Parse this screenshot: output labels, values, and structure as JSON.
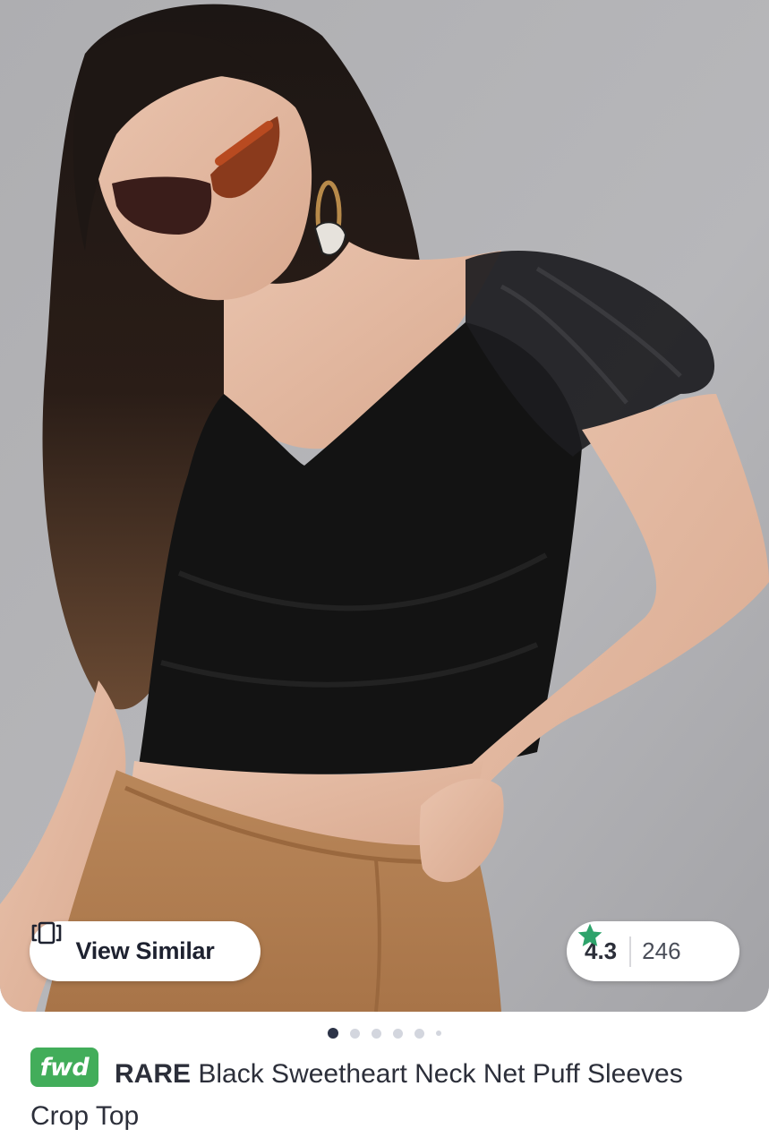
{
  "product": {
    "image_alt": "Model wearing black sweetheart neck crop top with puff net sleeves",
    "view_similar_label": "View Similar",
    "rating": {
      "value": "4.3",
      "count": "246",
      "star_color": "#2ea36b"
    },
    "carousel": {
      "total_dots": 6,
      "active_index": 0
    },
    "badge": "fwd",
    "badge_color": "#42ad5a",
    "brand": "RARE",
    "name": "Black Sweetheart Neck Net Puff Sleeves Crop Top"
  }
}
